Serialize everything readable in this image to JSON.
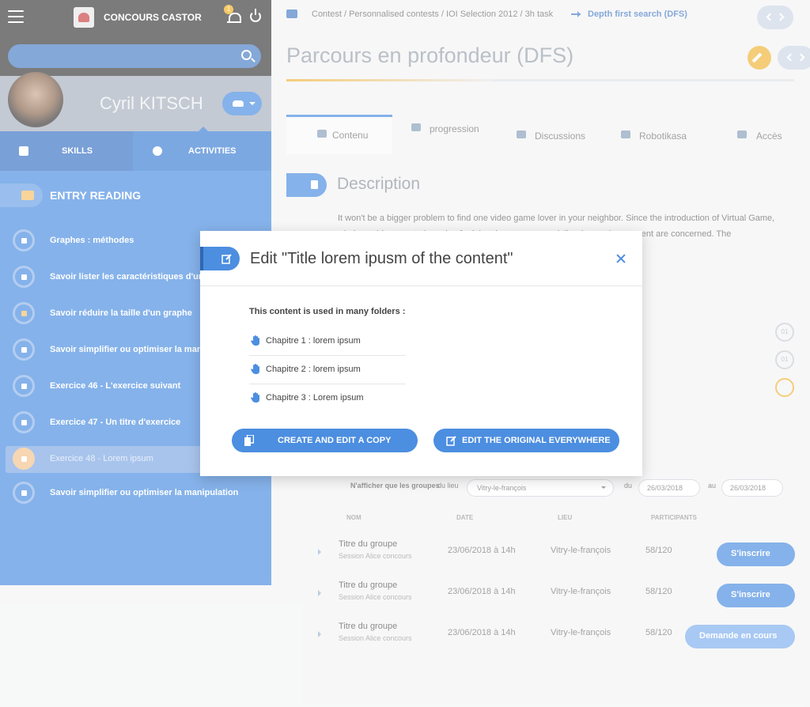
{
  "app": {
    "brand": "CONCOURS CASTOR",
    "notification_count": "1"
  },
  "user": {
    "name": "Cyril KITSCH"
  },
  "sidebar": {
    "tabs": [
      {
        "label": "SKILLS"
      },
      {
        "label": "ACTIVITIES"
      }
    ],
    "section": "ENTRY READING",
    "items": [
      {
        "label": "Graphes : méthodes"
      },
      {
        "label": "Savoir lister les caractéristiques d'un gr..."
      },
      {
        "label": "Savoir réduire la taille d'un graphe"
      },
      {
        "label": "Savoir simplifier ou optimiser la manipu..."
      },
      {
        "label": "Exercice 46 - L'exercice suivant"
      },
      {
        "label": "Exercice 47 - Un titre d'exercice"
      },
      {
        "label": "Exercice 48 - Lorem ipsum"
      },
      {
        "label": "Savoir simplifier ou optimiser la manipulation"
      }
    ]
  },
  "breadcrumb": {
    "path": "Contest / Personnalised contests / IOI Selection 2012 / 3h task",
    "current": "Depth first search (DFS)"
  },
  "page": {
    "title": "Parcours en profondeur (DFS)"
  },
  "content_tabs": [
    {
      "label": "Contenu"
    },
    {
      "label": "progression"
    },
    {
      "label": "Discussions"
    },
    {
      "label": "Robotikasa"
    },
    {
      "label": "Accès"
    }
  ],
  "description": {
    "title": "Description",
    "text": "It won't be a bigger problem to find one video game lover in your neighbor. Since the introduction of Virtual Game, whole world seems to be going for it in a hugeway, especially where advancement are concerned. The"
  },
  "statuses": [
    "01",
    "01"
  ],
  "filters": {
    "label": "N'afficher que les groupes",
    "place_label": "du lieu",
    "place_value": "Vitry-le-françois",
    "from_label": "du",
    "from_date": "26/03/2018",
    "to_label": "au",
    "to_date": "26/03/2018"
  },
  "table": {
    "headers": [
      "NOM",
      "DATE",
      "LIEU",
      "PARTICIPANTS"
    ],
    "rows": [
      {
        "title": "Titre du groupe",
        "sub": "Session Alice concours",
        "date": "23/06/2018 à 14h",
        "place": "Vitry-le-françois",
        "count": "58/120",
        "action": "S'inscrire"
      },
      {
        "title": "Titre du groupe",
        "sub": "Session Alice concours",
        "date": "23/06/2018 à 14h",
        "place": "Vitry-le-françois",
        "count": "58/120",
        "action": "S'inscrire"
      },
      {
        "title": "Titre du groupe",
        "sub": "Session Alice concours",
        "date": "23/06/2018 à 14h",
        "place": "Vitry-le-françois",
        "count": "58/120",
        "action": "Demande en cours"
      }
    ]
  },
  "modal": {
    "title": "Edit \"Title lorem ipusm of the content\"",
    "used_label": "This content is used in many folders :",
    "folders": [
      {
        "label": "Chapitre 1 : lorem ipsum"
      },
      {
        "label": "Chapitre 2 : lorem ipsum"
      },
      {
        "label": "Chapitre 3 : Lorem ipsum"
      }
    ],
    "copy_button": "CREATE AND EDIT A COPY",
    "edit_button": "EDIT THE ORIGINAL EVERYWHERE"
  },
  "colors": {
    "primary": "#4c8ee0",
    "accent": "#f0b53a",
    "dark": "#3d3d3d"
  }
}
